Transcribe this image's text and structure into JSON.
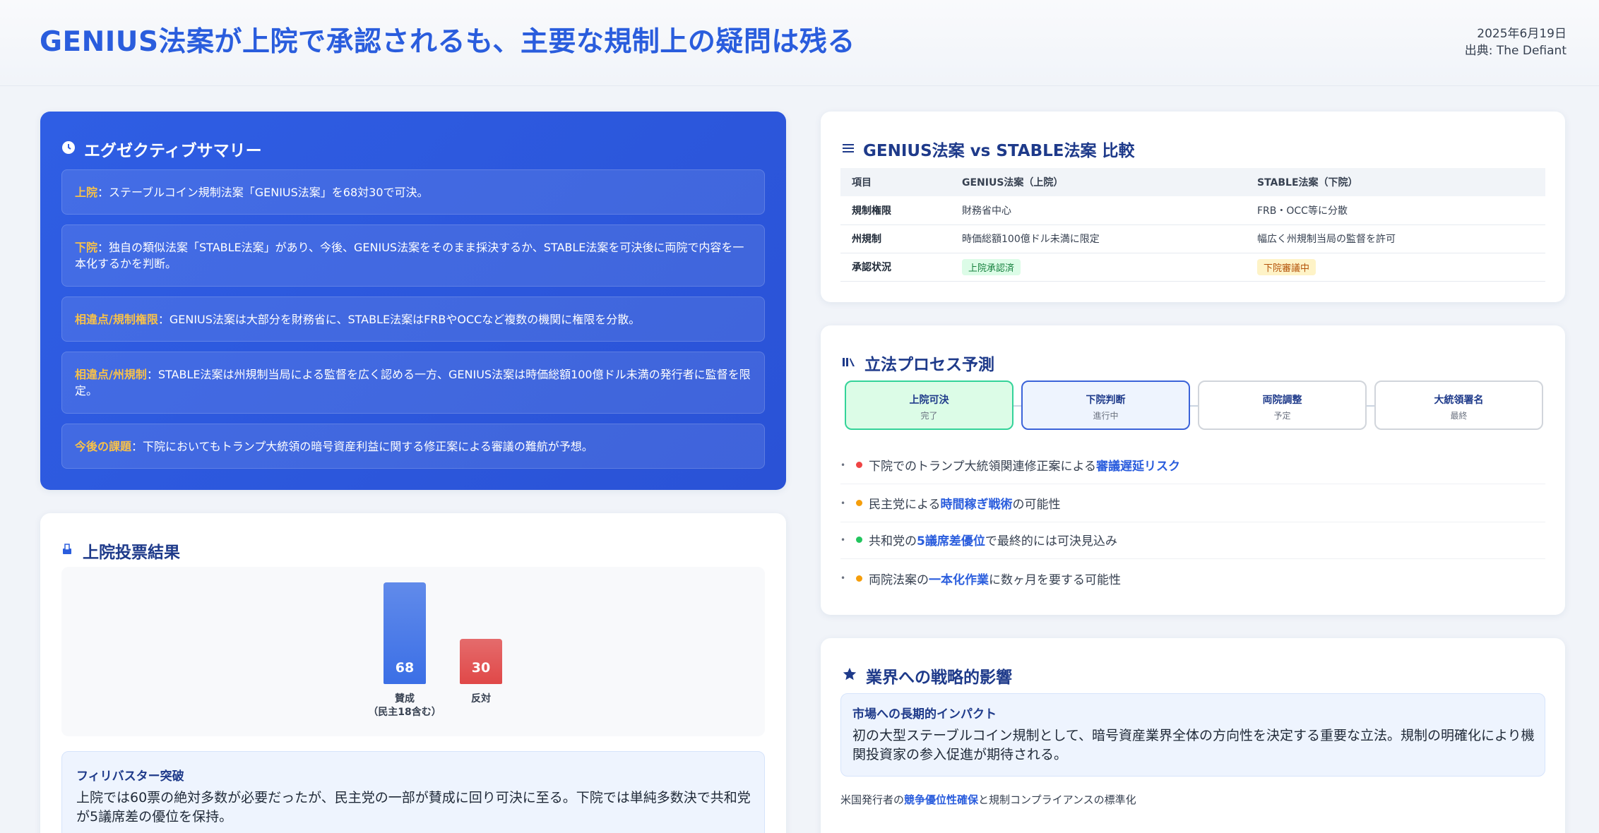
{
  "header": {
    "title": "GENIUS法案が上院で承認されるも、主要な規制上の疑問は残る",
    "date": "2025年6月19日",
    "source": "出典: The Defiant"
  },
  "summary": {
    "title": "エグゼクティブサマリー",
    "icon": "clock-icon",
    "items": [
      {
        "key": "上院",
        "text": "：ステーブルコイン規制法案「GENIUS法案」を68対30で可決。"
      },
      {
        "key": "下院",
        "text": "：独自の類似法案「STABLE法案」があり、今後、GENIUS法案をそのまま採決するか、STABLE法案を可決後に両院で内容を一本化するかを判断。"
      },
      {
        "key": "相違点/規制権限",
        "text": "：GENIUS法案は大部分を財務省に、STABLE法案はFRBやOCCなど複数の機関に権限を分散。"
      },
      {
        "key": "相違点/州規制",
        "text": "：STABLE法案は州規制当局による監督を広く認める一方、GENIUS法案は時価総額100億ドル未満の発行者に監督を限定。"
      },
      {
        "key": "今後の課題",
        "text": "：下院においてもトランプ大統領の暗号資産利益に関する修正案による審議の難航が予想。"
      }
    ]
  },
  "vote": {
    "title": "上院投票結果",
    "icon": "ballot-icon",
    "filibuster_title": "フィリバスター突破",
    "filibuster_text": "上院では60票の絶対多数が必要だったが、民主党の一部が賛成に回り可決に至る。下院では単純多数決で共和党が5議席差の優位を保持。"
  },
  "chart_data": {
    "type": "bar",
    "categories": [
      "賛成",
      "反対"
    ],
    "category_notes": [
      "（民主18含む）",
      ""
    ],
    "values": [
      68,
      30
    ],
    "colors": [
      "#3b6fe6",
      "#e04848"
    ],
    "ylim": [
      0,
      68
    ]
  },
  "compare": {
    "title": "GENIUS法案 vs STABLE法案 比較",
    "icon": "list-icon",
    "headers": [
      "項目",
      "GENIUS法案（上院）",
      "STABLE法案（下院）"
    ],
    "rows": [
      [
        "規制権限",
        "財務省中心",
        "FRB・OCC等に分散"
      ],
      [
        "州規制",
        "時価総額100億ドル未満に限定",
        "幅広く州規制当局の監督を許可"
      ],
      [
        "承認状況",
        "上院承認済",
        "下院審議中"
      ]
    ]
  },
  "process": {
    "title": "立法プロセス予測",
    "icon": "columns-icon",
    "steps": [
      {
        "name": "上院可決",
        "status": "完了"
      },
      {
        "name": "下院判断",
        "status": "進行中"
      },
      {
        "name": "両院調整",
        "status": "予定"
      },
      {
        "name": "大統領署名",
        "status": "最終"
      }
    ],
    "risks": [
      {
        "pre": "下院でのトランプ大統領関連修正案による",
        "em": "審議遅延リスク",
        "post": "",
        "color": "#ef4444"
      },
      {
        "pre": "民主党による",
        "em": "時間稼ぎ戦術",
        "post": "の可能性",
        "color": "#f59e0b"
      },
      {
        "pre": "共和党の",
        "em": "5議席差優位",
        "post": "で最終的には可決見込み",
        "color": "#22c55e"
      },
      {
        "pre": "両院法案の",
        "em": "一本化作業",
        "post": "に数ヶ月を要する可能性",
        "color": "#f59e0b"
      }
    ]
  },
  "impact": {
    "title": "業界への戦略的影響",
    "icon": "star-icon",
    "box_title": "市場への長期的インパクト",
    "box_text": "初の大型ステーブルコイン規制として、暗号資産業界全体の方向性を決定する重要な立法。規制の明確化により機関投資家の参入促進が期待される。",
    "foot_pre": "米国発行者の",
    "foot_em": "競争優位性確保",
    "foot_post": "と規制コンプライアンスの標準化"
  }
}
